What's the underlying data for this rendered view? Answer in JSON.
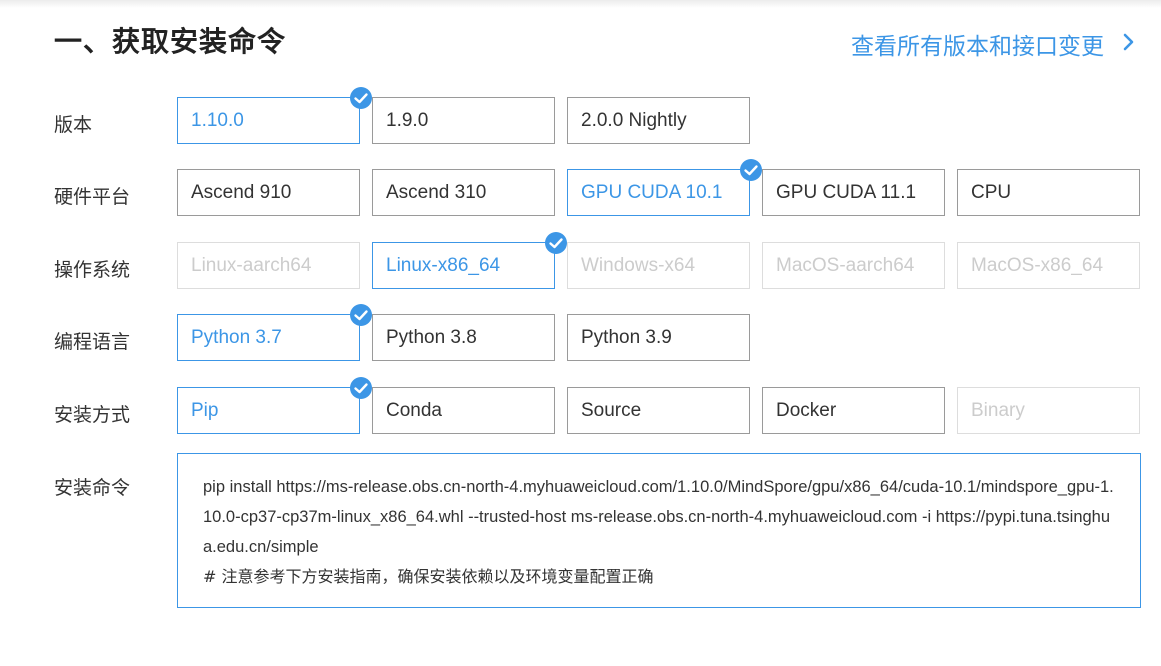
{
  "header": {
    "title": "一、获取安装命令",
    "changes_link": "查看所有版本和接口变更"
  },
  "rows": {
    "version": {
      "label": "版本",
      "options": [
        "1.10.0",
        "1.9.0",
        "2.0.0 Nightly"
      ],
      "selected": "1.10.0"
    },
    "hardware": {
      "label": "硬件平台",
      "options": [
        "Ascend 910",
        "Ascend 310",
        "GPU CUDA 10.1",
        "GPU CUDA 11.1",
        "CPU"
      ],
      "selected": "GPU CUDA 10.1"
    },
    "os": {
      "label": "操作系统",
      "options": [
        "Linux-aarch64",
        "Linux-x86_64",
        "Windows-x64",
        "MacOS-aarch64",
        "MacOS-x86_64"
      ],
      "selected": "Linux-x86_64",
      "disabled": [
        "Linux-aarch64",
        "Windows-x64",
        "MacOS-aarch64",
        "MacOS-x86_64"
      ]
    },
    "language": {
      "label": "编程语言",
      "options": [
        "Python 3.7",
        "Python 3.8",
        "Python 3.9"
      ],
      "selected": "Python 3.7"
    },
    "method": {
      "label": "安装方式",
      "options": [
        "Pip",
        "Conda",
        "Source",
        "Docker",
        "Binary"
      ],
      "selected": "Pip",
      "disabled": [
        "Binary"
      ]
    },
    "command": {
      "label": "安装命令",
      "text": "pip install https://ms-release.obs.cn-north-4.myhuaweicloud.com/1.10.0/MindSpore/gpu/x86_64/cuda-10.1/mindspore_gpu-1.10.0-cp37-cp37m-linux_x86_64.whl --trusted-host ms-release.obs.cn-north-4.myhuaweicloud.com -i https://pypi.tuna.tsinghua.edu.cn/simple",
      "note": "# 注意参考下方安装指南，确保安装依赖以及环境变量配置正确"
    }
  },
  "icons": {
    "selected_marker": "check-circle-icon",
    "link_arrow": "chevron-right-icon"
  },
  "colors": {
    "accent": "#3c96e6",
    "border": "#9a9a9a",
    "disabled_text": "#cccccc",
    "text": "#333333"
  }
}
